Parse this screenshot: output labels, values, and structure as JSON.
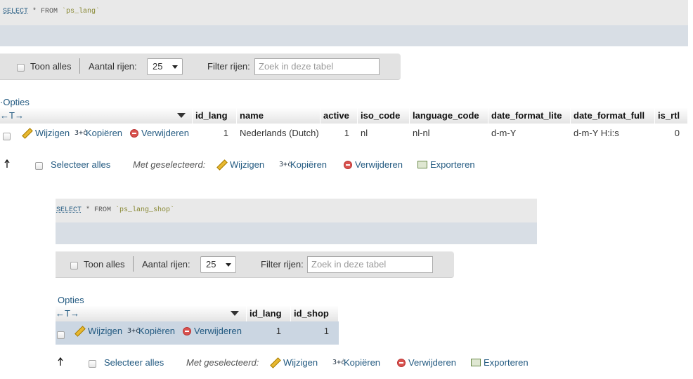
{
  "query1": {
    "sql_keyword": "SELECT",
    "sql_star": " * FROM ",
    "sql_table": "`ps_lang`",
    "nav": {
      "show_all": "Toon alles",
      "rows_label": "Aantal rijen:",
      "rows_value": "25",
      "filter_label": "Filter rijen:",
      "filter_placeholder": "Zoek in deze tabel"
    },
    "options_label": "Opties",
    "col_arrows": "←T→",
    "columns": [
      "id_lang",
      "name",
      "active",
      "iso_code",
      "language_code",
      "date_format_lite",
      "date_format_full",
      "is_rtl"
    ],
    "rows": [
      {
        "edit": "Wijzigen",
        "copy": "Kopiëren",
        "delete": "Verwijderen",
        "id_lang": "1",
        "name": "Nederlands (Dutch)",
        "active": "1",
        "iso_code": "nl",
        "language_code": "nl-nl",
        "date_format_lite": "d-m-Y",
        "date_format_full": "d-m-Y H:i:s",
        "is_rtl": "0"
      }
    ],
    "bulk": {
      "select_all": "Selecteer alles",
      "with_selected": "Met geselecteerd:",
      "edit": "Wijzigen",
      "copy": "Kopiëren",
      "delete": "Verwijderen",
      "export": "Exporteren"
    }
  },
  "query2": {
    "sql_keyword": "SELECT",
    "sql_star": " * FROM ",
    "sql_table": "`ps_lang_shop`",
    "nav": {
      "show_all": "Toon alles",
      "rows_label": "Aantal rijen:",
      "rows_value": "25",
      "filter_label": "Filter rijen:",
      "filter_placeholder": "Zoek in deze tabel"
    },
    "options_label": "Opties",
    "col_arrows": "←T→",
    "columns": [
      "id_lang",
      "id_shop"
    ],
    "rows": [
      {
        "edit": "Wijzigen",
        "copy": "Kopiëren",
        "delete": "Verwijderen",
        "id_lang": "1",
        "id_shop": "1"
      }
    ],
    "bulk": {
      "select_all": "Selecteer alles",
      "with_selected": "Met geselecteerd:",
      "edit": "Wijzigen",
      "copy": "Kopiëren",
      "delete": "Verwijderen",
      "export": "Exporteren"
    }
  },
  "colors": {
    "link": "#235a81",
    "sql_box": "#e9e9e9",
    "sql_bar": "#d8dee5",
    "nav_bar": "#e2e2e2",
    "row_highlight": "#cbd6e2",
    "delete_red": "#d9534f"
  },
  "icons": [
    "pencil-icon",
    "copy-icon",
    "delete-icon",
    "export-icon",
    "return-arrow-icon",
    "dropdown-caret-icon"
  ]
}
